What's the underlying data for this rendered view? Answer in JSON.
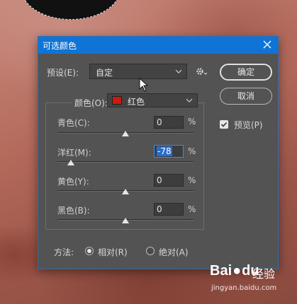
{
  "dialog": {
    "title": "可选颜色",
    "preset_label": "预设(E):",
    "preset_value": "自定",
    "ok_label": "确定",
    "cancel_label": "取消",
    "preview_label": "预览(P)",
    "preview_checked": true,
    "colors_label": "颜色(O):",
    "colors_value": "红色",
    "colors_swatch": "#cc1a10",
    "sliders": [
      {
        "label": "青色(C):",
        "value": "0",
        "unit": "%",
        "level": 0
      },
      {
        "label": "洋红(M):",
        "value": "-78",
        "unit": "%",
        "level": -78
      },
      {
        "label": "黄色(Y):",
        "value": "0",
        "unit": "%",
        "level": 0
      },
      {
        "label": "黑色(B):",
        "value": "0",
        "unit": "%",
        "level": 0
      }
    ],
    "method_label": "方法:",
    "method_options": [
      {
        "label": "相对(R)",
        "selected": true
      },
      {
        "label": "绝对(A)",
        "selected": false
      }
    ],
    "accent_color": "#0f74d6"
  },
  "watermark": {
    "brand": "Bai",
    "brand_tail": "du",
    "jingyan": "经验",
    "url": "jingyan.baidu.com"
  }
}
